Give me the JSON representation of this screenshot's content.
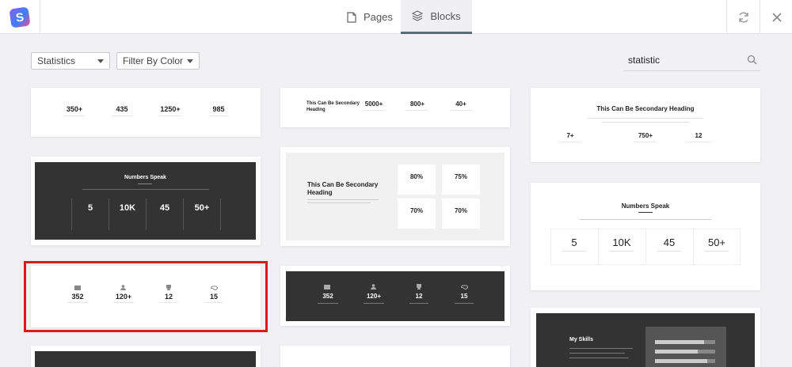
{
  "header": {
    "tabs": [
      {
        "label": "Pages",
        "icon": "page-icon"
      },
      {
        "label": "Blocks",
        "icon": "layers-icon",
        "active": true
      }
    ]
  },
  "filters": {
    "category": "Statistics",
    "color": "Filter By Color"
  },
  "search": {
    "value": "statistic"
  },
  "blocks": {
    "b1": {
      "items": [
        {
          "n": "350+"
        },
        {
          "n": "435"
        },
        {
          "n": "1250+"
        },
        {
          "n": "985"
        }
      ]
    },
    "b2": {
      "heading": "This Can Be Secondary Heading",
      "items": [
        {
          "n": "5000+"
        },
        {
          "n": "800+"
        },
        {
          "n": "40+"
        }
      ]
    },
    "b3": {
      "heading": "This Can Be Secondary Heading",
      "items": [
        {
          "n": "7+"
        },
        {
          "n": "750+"
        },
        {
          "n": "12"
        }
      ]
    },
    "b4": {
      "heading": "Numbers Speak",
      "items": [
        {
          "n": "5"
        },
        {
          "n": "10K"
        },
        {
          "n": "45"
        },
        {
          "n": "50+"
        }
      ]
    },
    "b5": {
      "heading": "This Can Be Secondary Heading",
      "items": [
        {
          "n": "80%"
        },
        {
          "n": "75%"
        },
        {
          "n": "70%"
        },
        {
          "n": "70%"
        }
      ]
    },
    "b6": {
      "heading": "Numbers Speak",
      "items": [
        {
          "n": "5"
        },
        {
          "n": "10K"
        },
        {
          "n": "45"
        },
        {
          "n": "50+"
        }
      ]
    },
    "b7": {
      "items": [
        {
          "n": "352"
        },
        {
          "n": "120+"
        },
        {
          "n": "12"
        },
        {
          "n": "15"
        }
      ]
    },
    "b8": {
      "items": [
        {
          "n": "352"
        },
        {
          "n": "120+"
        },
        {
          "n": "12"
        },
        {
          "n": "15"
        }
      ]
    },
    "b9": {
      "heading": "My Skills"
    }
  }
}
